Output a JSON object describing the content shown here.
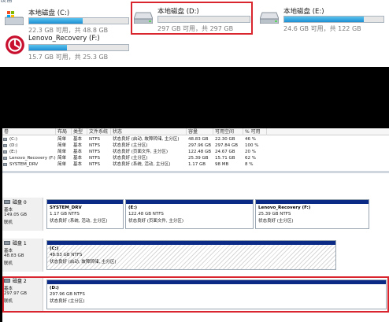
{
  "explorer": {
    "top_strip_text": "设备",
    "drives": [
      {
        "name": "本地磁盘 (C:)",
        "size_text": "22.3 GB 可用，共 48.8 GB",
        "used_fraction": 0.54,
        "icon": "windows-drive-icon"
      },
      {
        "name": "本地磁盘 (D:)",
        "size_text": "297 GB 可用，共 297 GB",
        "used_fraction": 0.0,
        "icon": "hard-drive-icon",
        "selected": true
      },
      {
        "name": "本地磁盘 (E:)",
        "size_text": "24.6 GB 可用，共 122 GB",
        "used_fraction": 0.8,
        "icon": "hard-drive-icon"
      },
      {
        "name": "Lenovo_Recovery (F:)",
        "size_text": "15.7 GB 可用，共 25.3 GB",
        "used_fraction": 0.38,
        "icon": "lenovo-recovery-icon"
      }
    ]
  },
  "disk_management": {
    "columns": [
      "卷",
      "布局",
      "类型",
      "文件系统",
      "状态",
      "容量",
      "可用空间",
      "% 可用"
    ],
    "volumes": [
      [
        "(C:)",
        "简单",
        "基本",
        "NTFS",
        "状态良好 (启动, 故障转储, 主分区)",
        "48.83 GB",
        "22.30 GB",
        "46 %"
      ],
      [
        "(D:)",
        "简单",
        "基本",
        "NTFS",
        "状态良好 (主分区)",
        "297.96 GB",
        "297.84 GB",
        "100 %"
      ],
      [
        "(E:)",
        "简单",
        "基本",
        "NTFS",
        "状态良好 (页面文件, 主分区)",
        "122.48 GB",
        "24.67 GB",
        "20 %"
      ],
      [
        "Lenovo_Recovery (F:)",
        "简单",
        "基本",
        "NTFS",
        "状态良好 (主分区)",
        "25.39 GB",
        "15.71 GB",
        "62 %"
      ],
      [
        "SYSTEM_DRV",
        "简单",
        "基本",
        "NTFS",
        "状态良好 (系统, 活动, 主分区)",
        "1.17 GB",
        "98 MB",
        "8 %"
      ]
    ],
    "disks": [
      {
        "name": "磁盘 0",
        "type": "基本",
        "size": "149.05 GB",
        "status": "联机",
        "partitions": [
          {
            "name": "SYSTEM_DRV",
            "line1": "1.17 GB NTFS",
            "line2": "状态良好 (系统, 活动, 主分区)"
          },
          {
            "name": "(E:)",
            "line1": "122.48 GB NTFS",
            "line2": "状态良好 (页面文件, 主分区)"
          },
          {
            "name": "Lenovo_Recovery (F:)",
            "line1": "25.39 GB NTFS",
            "line2": "状态良好 (主分区)"
          }
        ]
      },
      {
        "name": "磁盘 1",
        "type": "基本",
        "size": "48.83 GB",
        "status": "联机",
        "partitions": [
          {
            "name": "(C:)",
            "line1": "48.83 GB NTFS",
            "line2": "状态良好 (启动, 故障转储, 主分区)"
          }
        ]
      },
      {
        "name": "磁盘 2",
        "type": "基本",
        "size": "297.97 GB",
        "status": "联机",
        "partitions": [
          {
            "name": "(D:)",
            "line1": "297.96 GB NTFS",
            "line2": "状态良好 (主分区)"
          }
        ]
      }
    ]
  },
  "colors": {
    "highlight": "#d9252d",
    "partition_bar": "#0a2a86",
    "progress": "#1d8fd3"
  }
}
